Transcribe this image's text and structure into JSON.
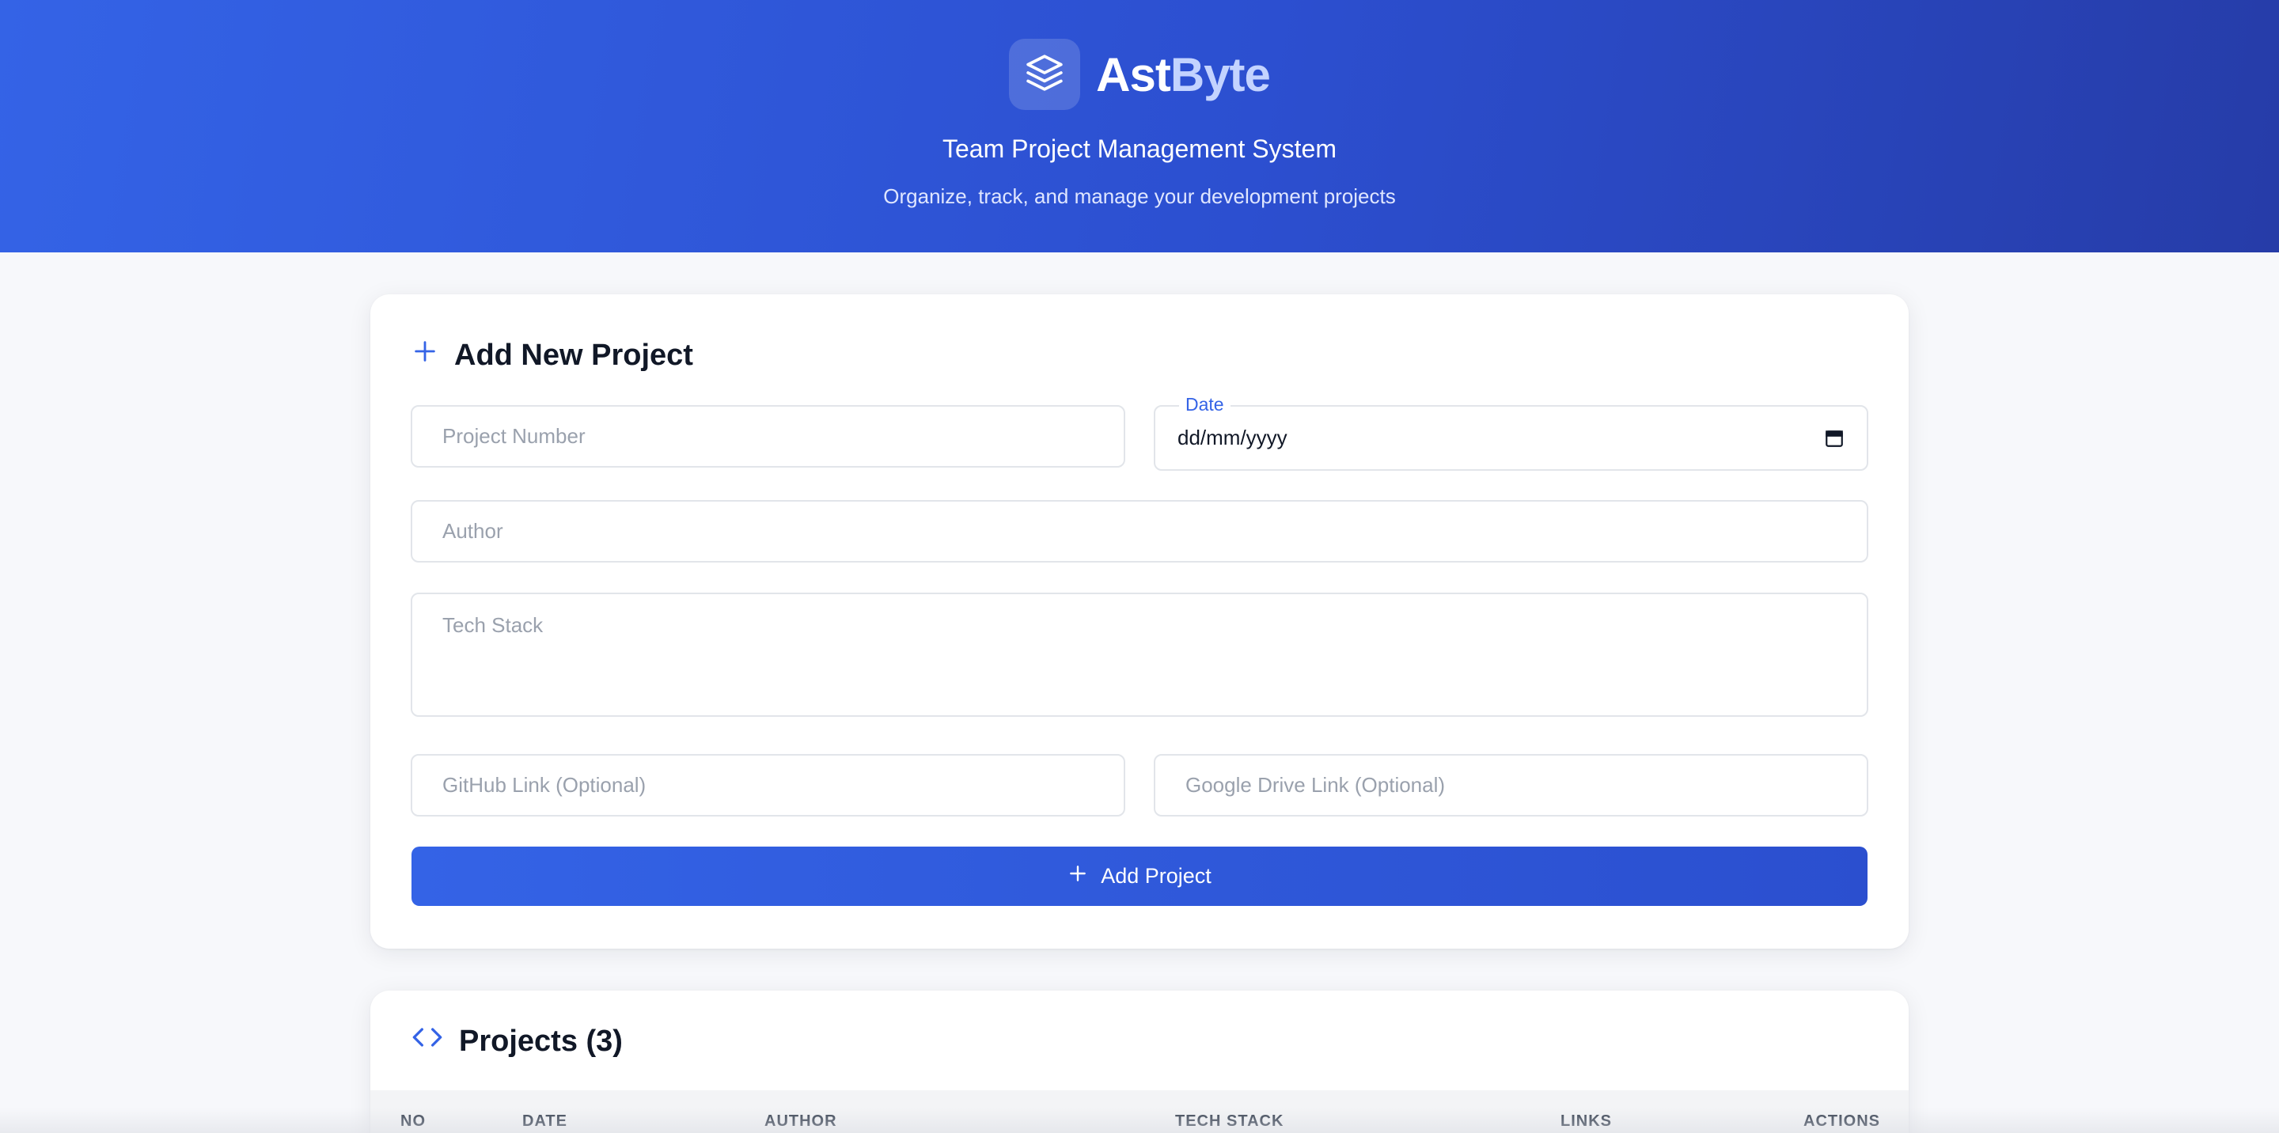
{
  "brand": {
    "name_part1": "Ast",
    "name_part2": "Byte",
    "tagline": "Team Project Management System",
    "subtagline": "Organize, track, and manage your development projects",
    "logo_icon": "layers-icon"
  },
  "form": {
    "title": "Add New Project",
    "title_icon": "plus-icon",
    "project_number": {
      "placeholder": "Project Number",
      "value": ""
    },
    "date": {
      "label": "Date",
      "value": "dd/mm/yyyy",
      "icon": "calendar-icon"
    },
    "author": {
      "placeholder": "Author",
      "value": ""
    },
    "tech_stack": {
      "placeholder": "Tech Stack",
      "value": ""
    },
    "github": {
      "placeholder": "GitHub Link (Optional)",
      "value": ""
    },
    "drive": {
      "placeholder": "Google Drive Link (Optional)",
      "value": ""
    },
    "submit_label": "Add Project",
    "submit_icon": "plus-icon"
  },
  "projects": {
    "title": "Projects (3)",
    "title_icon": "code-icon",
    "columns": [
      "NO",
      "DATE",
      "AUTHOR",
      "TECH STACK",
      "LINKS",
      "ACTIONS"
    ]
  },
  "colors": {
    "accent": "#3463e6",
    "header_gradient_start": "#3463e6",
    "header_gradient_end": "#263ca8",
    "brand_highlight": "#c3d3ff"
  }
}
